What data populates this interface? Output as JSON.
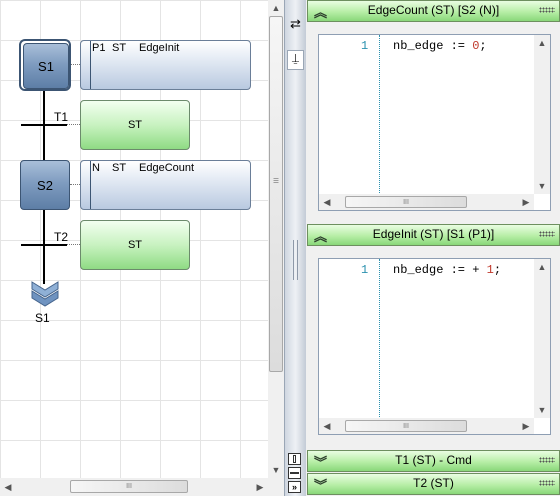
{
  "sfc": {
    "steps": [
      {
        "id": "S1",
        "initial": true,
        "qualifier": "P1",
        "action_type": "ST",
        "action_name": "EdgeInit"
      },
      {
        "id": "S2",
        "initial": false,
        "qualifier": "N",
        "action_type": "ST",
        "action_name": "EdgeCount"
      }
    ],
    "transitions": [
      {
        "id": "T1",
        "body": "ST"
      },
      {
        "id": "T2",
        "body": "ST"
      }
    ],
    "jump_target": "S1"
  },
  "toolbar": {
    "swap_icon": "⇄",
    "pin_icon": "⍊"
  },
  "panels": [
    {
      "title": "EdgeCount (ST) [S2 (N)]",
      "expanded": true,
      "line": "1",
      "code_pre": "nb_edge := ",
      "code_num": "0",
      "code_post": ";"
    },
    {
      "title": "EdgeInit (ST) [S1 (P1)]",
      "expanded": true,
      "line": "1",
      "code_pre": "nb_edge := + ",
      "code_num": "1",
      "code_post": ";"
    },
    {
      "title": "T1 (ST) - Cmd",
      "expanded": false
    },
    {
      "title": "T2 (ST)",
      "expanded": false
    }
  ],
  "scrollbar_grip": "III",
  "colors": {
    "step_blue": "#7f9cc0",
    "transition_green": "#a9e59c",
    "line_number": "#2b91af",
    "number_literal": "#c0392b"
  }
}
